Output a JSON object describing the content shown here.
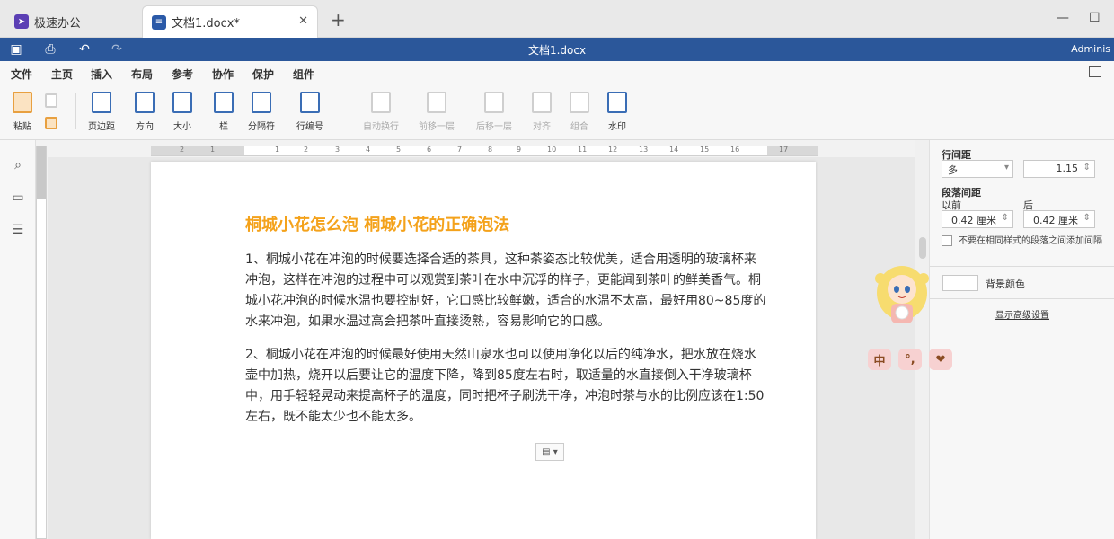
{
  "tabs": {
    "app_label": "极速办公",
    "doc_label": "文档1.docx*",
    "new_tab": "+"
  },
  "titlebar": {
    "title": "文档1.docx",
    "user": "Adminis"
  },
  "menu": [
    "文件",
    "主页",
    "插入",
    "布局",
    "参考",
    "协作",
    "保护",
    "组件"
  ],
  "active_menu": "布局",
  "ribbon": {
    "paste": "粘贴",
    "margins": "页边距",
    "orientation": "方向",
    "size": "大小",
    "columns": "栏",
    "breaks": "分隔符",
    "line_numbers": "行编号",
    "wrap": "自动换行",
    "bring_forward": "前移一层",
    "send_backward": "后移一层",
    "align": "对齐",
    "group": "组合",
    "watermark": "水印"
  },
  "ruler_ticks": [
    "2",
    "1",
    "1",
    "2",
    "3",
    "4",
    "5",
    "6",
    "7",
    "8",
    "9",
    "10",
    "11",
    "12",
    "13",
    "14",
    "15",
    "16",
    "17"
  ],
  "document": {
    "title": "桐城小花怎么泡 桐城小花的正确泡法",
    "paragraphs": [
      "1、桐城小花在冲泡的时候要选择合适的茶具，这种茶姿态比较优美，适合用透明的玻璃杯来冲泡，这样在冲泡的过程中可以观赏到茶叶在水中沉浮的样子，更能闻到茶叶的鲜美香气。桐城小花冲泡的时候水温也要控制好，它口感比较鲜嫩，适合的水温不太高，最好用80~85度的水来冲泡，如果水温过高会把茶叶直接烫熟，容易影响它的口感。",
      "2、桐城小花在冲泡的时候最好使用天然山泉水也可以使用净化以后的纯净水，把水放在烧水壶中加热，烧开以后要让它的温度下降，降到85度左右时，取适量的水直接倒入干净玻璃杯中，用手轻轻晃动来提高杯子的温度，同时把杯子刷洗干净，冲泡时茶与水的比例应该在1:50左右，既不能太少也不能太多。"
    ]
  },
  "panel": {
    "line_spacing_label": "行间距",
    "line_spacing_mode": "多",
    "line_spacing_value": "1.15",
    "para_spacing_label": "段落间距",
    "before_label": "以前",
    "after_label": "后",
    "before_value": "0.42 厘米",
    "after_value": "0.42 厘米",
    "no_space_same_style": "不要在相同样式的段落之间添加间隔",
    "bg_color_label": "背景颜色",
    "advanced_link": "显示高级设置"
  },
  "ime": [
    "中",
    "°,",
    "❤"
  ],
  "colors": {
    "brand_blue": "#2b579a",
    "title_orange": "#f4a21b"
  }
}
